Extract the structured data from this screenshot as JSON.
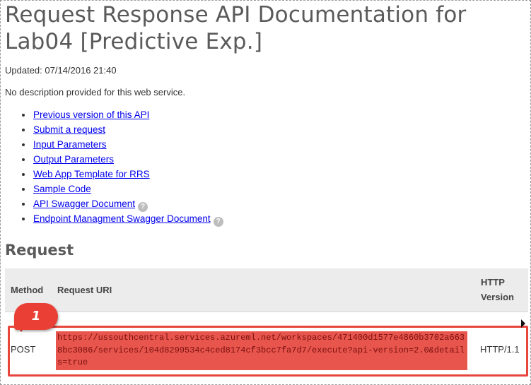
{
  "title": "Request Response API Documentation for Lab04 [Predictive Exp.]",
  "updated": "Updated: 07/14/2016 21:40",
  "description": "No description provided for this web service.",
  "links": [
    {
      "label": "Previous version of this API",
      "help": false
    },
    {
      "label": "Submit a request",
      "help": false
    },
    {
      "label": "Input Parameters",
      "help": false
    },
    {
      "label": "Output Parameters",
      "help": false
    },
    {
      "label": "Web App Template for RRS",
      "help": false
    },
    {
      "label": "Sample Code",
      "help": false
    },
    {
      "label": "API Swagger Document",
      "help": true
    },
    {
      "label": "Endpoint Managment Swagger Document",
      "help": true
    }
  ],
  "help_glyph": "?",
  "section_title": "Request",
  "table": {
    "headers": {
      "method": "Method",
      "uri": "Request URI",
      "version": "HTTP Version"
    },
    "row": {
      "method": "POST",
      "uri": "https://ussouthcentral.services.azureml.net/workspaces/471400d1577e4860b3702a6638bc3086/services/104d8299534c4ced8174cf3bcc7fa7d7/execute?api-version=2.0&details=true",
      "version": "HTTP/1.1"
    }
  },
  "annotation": {
    "badge": "1",
    "color": "#ea3f34"
  },
  "colors": {
    "link": "#0000ee",
    "heading": "#5a5a5a",
    "header_bg": "#ececec",
    "highlight": "#e8453c"
  }
}
